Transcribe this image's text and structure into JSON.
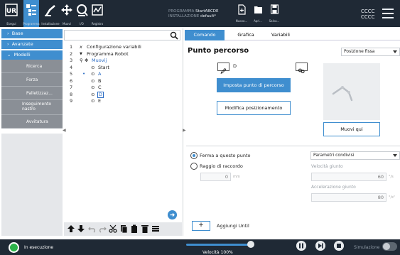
{
  "topbar": {
    "nav": [
      {
        "label": "Esegui",
        "icon": "ur-logo-icon"
      },
      {
        "label": "Programma",
        "icon": "program-icon"
      },
      {
        "label": "Installazione",
        "icon": "robot-arm-icon"
      },
      {
        "label": "Muovi",
        "icon": "move-arrows-icon"
      },
      {
        "label": "I/O",
        "icon": "io-icon"
      },
      {
        "label": "Registro",
        "icon": "log-chart-icon"
      }
    ],
    "programma_label": "PROGRAMMA",
    "programma_value": "StartABCDE",
    "installazione_label": "INSTALLAZIONE",
    "installazione_value": "default*",
    "file_buttons": [
      {
        "label": "Nuovo..."
      },
      {
        "label": "Apri..."
      },
      {
        "label": "Salva..."
      }
    ],
    "cccc_1": "CCCC",
    "cccc_2": "CCCC"
  },
  "tree": {
    "base": "Base",
    "avanzate": "Avanzate",
    "modelli": "Modelli",
    "items": [
      "Ricerca",
      "Forza",
      "Palletizzaz...",
      "Inseguimento nastro",
      "Avvitatura"
    ]
  },
  "program": {
    "lines": [
      {
        "n": "1",
        "text": "Configurazione variabili"
      },
      {
        "n": "2",
        "text": "Programma Robot"
      },
      {
        "n": "3",
        "text": "Muovij"
      },
      {
        "n": "4",
        "text": "Start"
      },
      {
        "n": "5",
        "text": "A"
      },
      {
        "n": "6",
        "text": "B"
      },
      {
        "n": "7",
        "text": "C"
      },
      {
        "n": "8",
        "text": "D"
      },
      {
        "n": "9",
        "text": "E"
      }
    ]
  },
  "tabs": [
    "Comando",
    "Grafica",
    "Variabili"
  ],
  "panel": {
    "title": "Punto percorso",
    "position_mode": "Posizione fissa",
    "waypoint_name": "D",
    "set_waypoint": "Imposta punto di percorso",
    "edit_position": "Modifica posizionamento",
    "move_here": "Muovi qui",
    "stop_here": "Ferma a questo punto",
    "blend_radius": "Raggio di raccordo",
    "radius_value": "0",
    "radius_unit": "mm",
    "shared_params": "Parametri condivisi",
    "speed_label": "Velocità giunto",
    "speed_value": "60",
    "speed_unit": "°/s",
    "accel_label": "Accelerazione giunto",
    "accel_value": "80",
    "accel_unit": "°/s²",
    "add_until": "Aggiungi Until",
    "add_until_icon": "+"
  },
  "bottombar": {
    "status": "In esecuzione",
    "speed": "Velocità 100%",
    "speed_fraction": 1.0,
    "simulation": "Simulazione"
  },
  "colors": {
    "accent": "#3f8ecf",
    "bar": "#1f2935",
    "status_green": "#2cb34a"
  }
}
